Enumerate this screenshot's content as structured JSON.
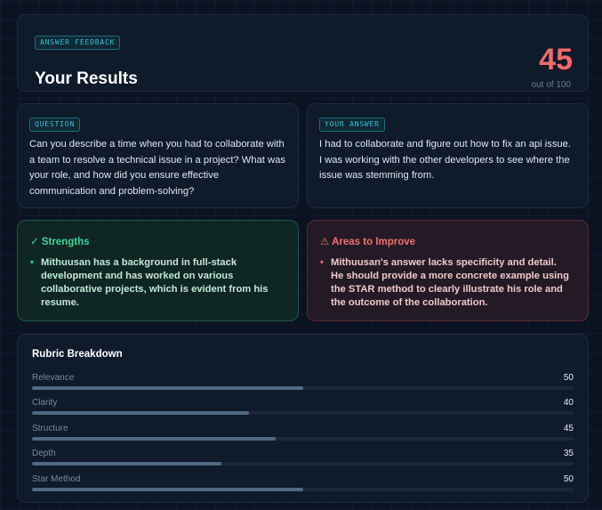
{
  "header": {
    "tag": "ANSWER FEEDBACK",
    "title": "Your Results",
    "score": "45",
    "out_of": "out of 100"
  },
  "question": {
    "tag": "QUESTION",
    "text": "Can you describe a time when you had to collaborate with a team to resolve a technical issue in a project? What was your role, and how did you ensure effective communication and problem-solving?"
  },
  "answer": {
    "tag": "YOUR ANSWER",
    "text": "I had to collaborate and figure out how to fix an api issue. I was working with the other developers to see where the issue was stemming from."
  },
  "strengths": {
    "icon": "check-icon",
    "icon_glyph": "✓",
    "title": "Strengths",
    "items": [
      "Mithuusan has a background in full-stack development and has worked on various collaborative projects, which is evident from his resume."
    ]
  },
  "improve": {
    "icon": "warning-triangle-icon",
    "icon_glyph": "⚠",
    "title": "Areas to Improve",
    "items": [
      "Mithuusan's answer lacks specificity and detail. He should provide a more concrete example using the STAR method to clearly illustrate his role and the outcome of the collaboration."
    ]
  },
  "rubric": {
    "title": "Rubric Breakdown",
    "max": 100,
    "rows": [
      {
        "label": "Relevance",
        "value": 50
      },
      {
        "label": "Clarity",
        "value": 40
      },
      {
        "label": "Structure",
        "value": 45
      },
      {
        "label": "Depth",
        "value": 35
      },
      {
        "label": "Star Method",
        "value": 50
      }
    ]
  },
  "colors": {
    "score": "#f16b6b",
    "strengths_accent": "#3ed39a",
    "improve_accent": "#f2716f",
    "tag_accent": "#39c1d6",
    "bar_fill": "#4f6a82"
  }
}
